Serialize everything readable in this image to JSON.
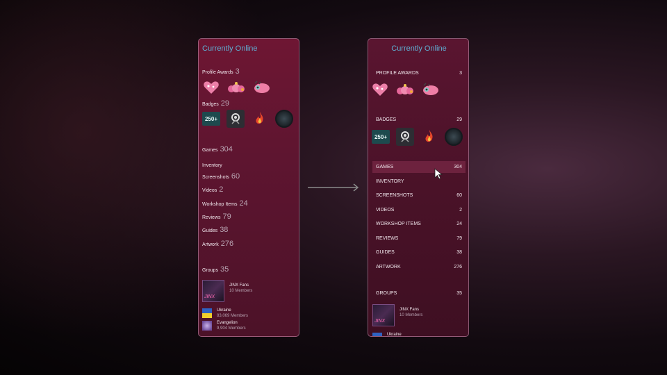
{
  "panel_a": {
    "title": "Currently Online",
    "rows": [
      {
        "label": "Profile Awards",
        "count": "3"
      },
      {
        "label": "Badges",
        "count": "29"
      },
      {
        "label": "Games",
        "count": "304"
      },
      {
        "label": "Inventory",
        "count": ""
      },
      {
        "label": "Screenshots",
        "count": "60"
      },
      {
        "label": "Videos",
        "count": "2"
      },
      {
        "label": "Workshop Items",
        "count": "24"
      },
      {
        "label": "Reviews",
        "count": "79"
      },
      {
        "label": "Guides",
        "count": "38"
      },
      {
        "label": "Artwork",
        "count": "276"
      },
      {
        "label": "Groups",
        "count": "35"
      }
    ],
    "badge_text": "250+",
    "groups": [
      {
        "name": "JINX Fans",
        "members": "10 Members",
        "avatar_text": "JINX"
      },
      {
        "name": "Ukraine",
        "members": "83,069 Members"
      },
      {
        "name": "Evangelion",
        "members": "9,904 Members"
      }
    ]
  },
  "panel_b": {
    "title": "Currently Online",
    "rows": [
      {
        "label": "PROFILE AWARDS",
        "count": "3"
      },
      {
        "label": "BADGES",
        "count": "29"
      },
      {
        "label": "GAMES",
        "count": "304"
      },
      {
        "label": "INVENTORY",
        "count": ""
      },
      {
        "label": "SCREENSHOTS",
        "count": "60"
      },
      {
        "label": "VIDEOS",
        "count": "2"
      },
      {
        "label": "WORKSHOP ITEMS",
        "count": "24"
      },
      {
        "label": "REVIEWS",
        "count": "79"
      },
      {
        "label": "GUIDES",
        "count": "38"
      },
      {
        "label": "ARTWORK",
        "count": "276"
      },
      {
        "label": "GROUPS",
        "count": "35"
      }
    ],
    "badge_text": "250+",
    "groups": [
      {
        "name": "JINX Fans",
        "members": "10 Members",
        "avatar_text": "JINX"
      },
      {
        "name": "Ukraine"
      }
    ]
  },
  "colors": {
    "title": "#5fb0d4",
    "panel": "#6e1633",
    "hover": "#782846"
  }
}
